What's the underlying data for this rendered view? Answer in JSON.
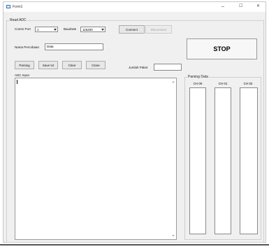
{
  "window": {
    "title": "Form1",
    "minimize": "–",
    "maximize": "☐",
    "close": "✕"
  },
  "read_adc": {
    "group_label": "Read ADC",
    "com_port_label": "Comm Port",
    "com_port_value": "1",
    "baudrate_label": "Baudrate",
    "baudrate_value": "115200",
    "connect_label": "Connect",
    "disconnect_label": "Disconnect",
    "nama_percobaan_label": "Nama Percobaan",
    "nama_percobaan_value": "Data",
    "stop_label": "STOP",
    "parsing_label": "Parsing",
    "save_txt_label": "Save txt",
    "clear_label": "Clear",
    "close_label": "Close",
    "jumlah_paket_label": "Jumlah Paket",
    "jumlah_paket_value": "",
    "adc_input_label": "ADC Input"
  },
  "parsing_data": {
    "group_label": "Parsing Data",
    "channels": [
      "CH 00",
      "CH 01",
      "CH 02"
    ]
  }
}
